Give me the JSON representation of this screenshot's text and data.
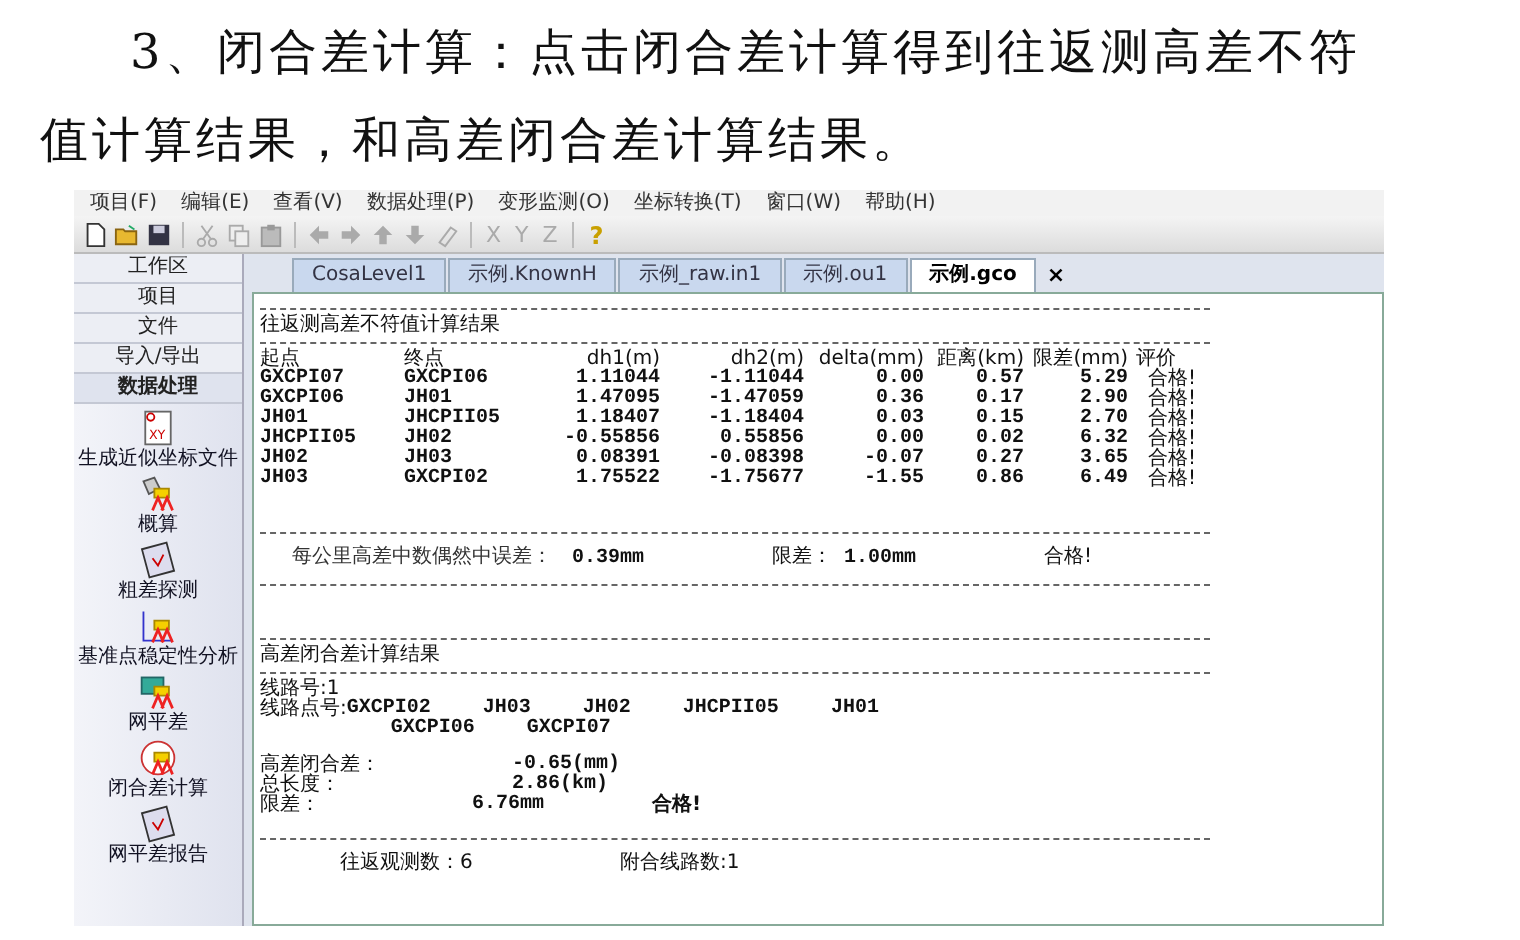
{
  "doc_paragraph": "3、闭合差计算：点击闭合差计算得到往返测高差不符值计算结果，和高差闭合差计算结果。",
  "menu": [
    "项目(F)",
    "编辑(E)",
    "查看(V)",
    "数据处理(P)",
    "变形监测(O)",
    "坐标转换(T)",
    "窗口(W)",
    "帮助(H)"
  ],
  "toolbar": [
    {
      "kind": "new"
    },
    {
      "kind": "open"
    },
    {
      "kind": "save"
    },
    {
      "kind": "sep"
    },
    {
      "kind": "cut"
    },
    {
      "kind": "copy"
    },
    {
      "kind": "paste"
    },
    {
      "kind": "sep"
    },
    {
      "kind": "left"
    },
    {
      "kind": "right"
    },
    {
      "kind": "up"
    },
    {
      "kind": "down"
    },
    {
      "kind": "eraser"
    },
    {
      "kind": "sep"
    },
    {
      "kind": "letter",
      "text": "X"
    },
    {
      "kind": "letter",
      "text": "Y"
    },
    {
      "kind": "letter",
      "text": "Z"
    },
    {
      "kind": "sep"
    },
    {
      "kind": "help",
      "text": "?"
    }
  ],
  "sidebar": {
    "header": "工作区",
    "sections": [
      {
        "label": "项目",
        "expanded": false
      },
      {
        "label": "文件",
        "expanded": false
      },
      {
        "label": "导入/导出",
        "expanded": false
      },
      {
        "label": "数据处理",
        "expanded": true
      }
    ],
    "tools": [
      {
        "label": "生成近似坐标文件",
        "kind": "xy",
        "icon_text": "XY"
      },
      {
        "label": "概算",
        "kind": "level"
      },
      {
        "label": "粗差探测",
        "kind": "clipboard"
      },
      {
        "label": "基准点稳定性分析",
        "kind": "axes"
      },
      {
        "label": "网平差",
        "kind": "grid"
      },
      {
        "label": "闭合差计算",
        "kind": "circle"
      },
      {
        "label": "网平差报告",
        "kind": "clipboard"
      }
    ]
  },
  "tabs": [
    {
      "label": "CosaLevel1",
      "selected": false
    },
    {
      "label": "示例.KnownH",
      "selected": false
    },
    {
      "label": "示例_raw.in1",
      "selected": false
    },
    {
      "label": "示例.ou1",
      "selected": false
    },
    {
      "label": "示例.gco",
      "selected": true
    }
  ],
  "tab_close": "×",
  "report": {
    "section1_title": "往返测高差不符值计算结果",
    "columns": [
      "起点",
      "终点",
      "dh1(m)",
      "dh2(m)",
      "delta(mm)",
      "距离(km)",
      "限差(mm)",
      "评价"
    ],
    "rows": [
      [
        "GXCPI07",
        "GXCPI06",
        "1.11044",
        "-1.11044",
        "0.00",
        "0.57",
        "5.29",
        "合格!"
      ],
      [
        "GXCPI06",
        "JH01",
        "1.47095",
        "-1.47059",
        "0.36",
        "0.17",
        "2.90",
        "合格!"
      ],
      [
        "JH01",
        "JHCPII05",
        "1.18407",
        "-1.18404",
        "0.03",
        "0.15",
        "2.70",
        "合格!"
      ],
      [
        "JHCPII05",
        "JH02",
        "-0.55856",
        "0.55856",
        "0.00",
        "0.02",
        "6.32",
        "合格!"
      ],
      [
        "JH02",
        "JH03",
        "0.08391",
        "-0.08398",
        "-0.07",
        "0.27",
        "3.65",
        "合格!"
      ],
      [
        "JH03",
        "GXCPI02",
        "1.75522",
        "-1.75677",
        "-1.55",
        "0.86",
        "6.49",
        "合格!"
      ]
    ],
    "summary": {
      "label": "每公里高差中数偶然中误差：",
      "value": "0.39mm",
      "limit_label": "限差：",
      "limit_value": "1.00mm",
      "result": "合格!"
    },
    "section2_title": "高差闭合差计算结果",
    "route_no": "线路号:1",
    "points_label": "线路点号:",
    "point_lines": [
      [
        "GXCPI02",
        "JH03",
        "JH02",
        "JHCPII05",
        "JH01"
      ],
      [
        "GXCPI06",
        "GXCPI07"
      ]
    ],
    "closure": {
      "label": "高差闭合差：",
      "value": "-0.65(mm)"
    },
    "length": {
      "label": "总长度：",
      "value": "2.86(km)"
    },
    "limit": {
      "label": "限差：",
      "value": "6.76mm",
      "result": "合格!"
    },
    "footer": [
      "往返观测数：6",
      "附合线路数:1"
    ]
  }
}
